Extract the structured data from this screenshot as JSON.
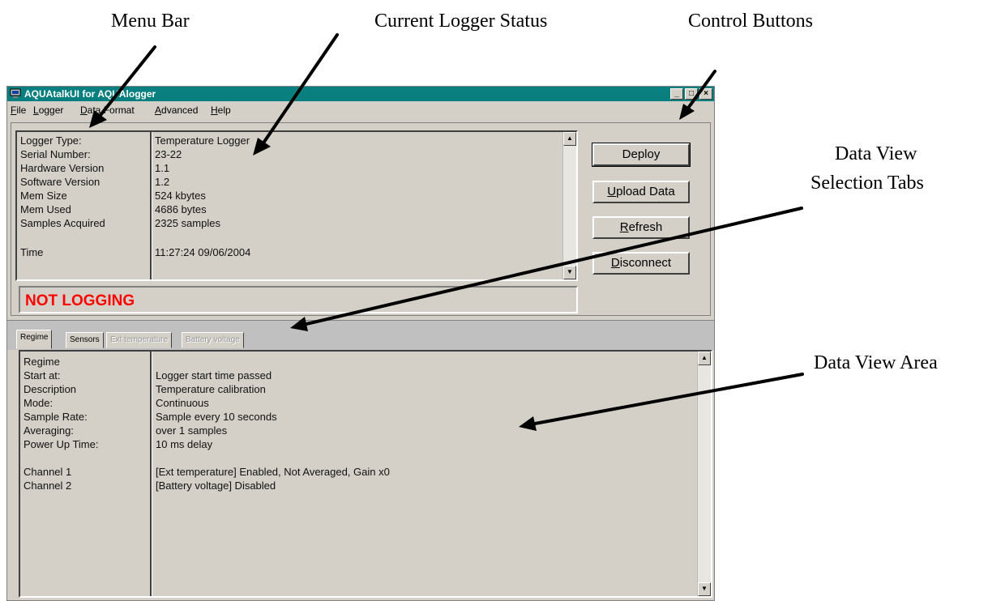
{
  "callouts": {
    "menu_bar": "Menu Bar",
    "current_logger_status": "Current Logger Status",
    "control_buttons": "Control Buttons",
    "data_view_selection_tabs_line1": "Data View",
    "data_view_selection_tabs_line2": "Selection Tabs",
    "data_view_area": "Data View Area"
  },
  "window": {
    "title": "AQUAtalkUI for AQUAlogger",
    "icon": "computer-icon"
  },
  "menu": [
    {
      "key": "F",
      "rest": "ile"
    },
    {
      "key": "L",
      "rest": "ogger"
    },
    {
      "key": "D",
      "rest": "ata Format"
    },
    {
      "key": "A",
      "rest": "dvanced"
    },
    {
      "key": "H",
      "rest": "elp"
    }
  ],
  "logger_info": {
    "labels": [
      "Logger Type:",
      "Serial Number:",
      "Hardware Version",
      "Software Version",
      "Mem Size",
      "Mem Used",
      "Samples Acquired",
      "Time"
    ],
    "values": [
      "Temperature Logger",
      "23-22",
      "1.1",
      "1.2",
      "524 kbytes",
      "4686 bytes",
      "2325 samples",
      "11:27:24 09/06/2004"
    ]
  },
  "logging_status": {
    "text": "NOT LOGGING",
    "color": "#ff0000"
  },
  "buttons": {
    "deploy": "Deploy",
    "upload_key": "U",
    "upload_rest": "pload Data",
    "refresh_key": "R",
    "refresh_rest": "efresh",
    "disconnect_key": "D",
    "disconnect_rest": "isconnect"
  },
  "tabs": [
    "Regime",
    "Sensors",
    "Ext temperature",
    "Battery voltage"
  ],
  "regime": {
    "labels": [
      "Regime",
      "Start at:",
      "Description",
      "Mode:",
      "Sample Rate:",
      "Averaging:",
      "Power Up Time:",
      "Channel 1",
      "Channel 2"
    ],
    "values": [
      "",
      "Logger start time passed",
      "Temperature calibration",
      "Continuous",
      "Sample every 10 seconds",
      "over 1 samples",
      "10 ms delay",
      "[Ext temperature] Enabled, Not Averaged, Gain x0",
      "[Battery voltage] Disabled"
    ]
  },
  "colors": {
    "title_bar": "#0a7f7f",
    "window_face": "#d4d0c8"
  }
}
